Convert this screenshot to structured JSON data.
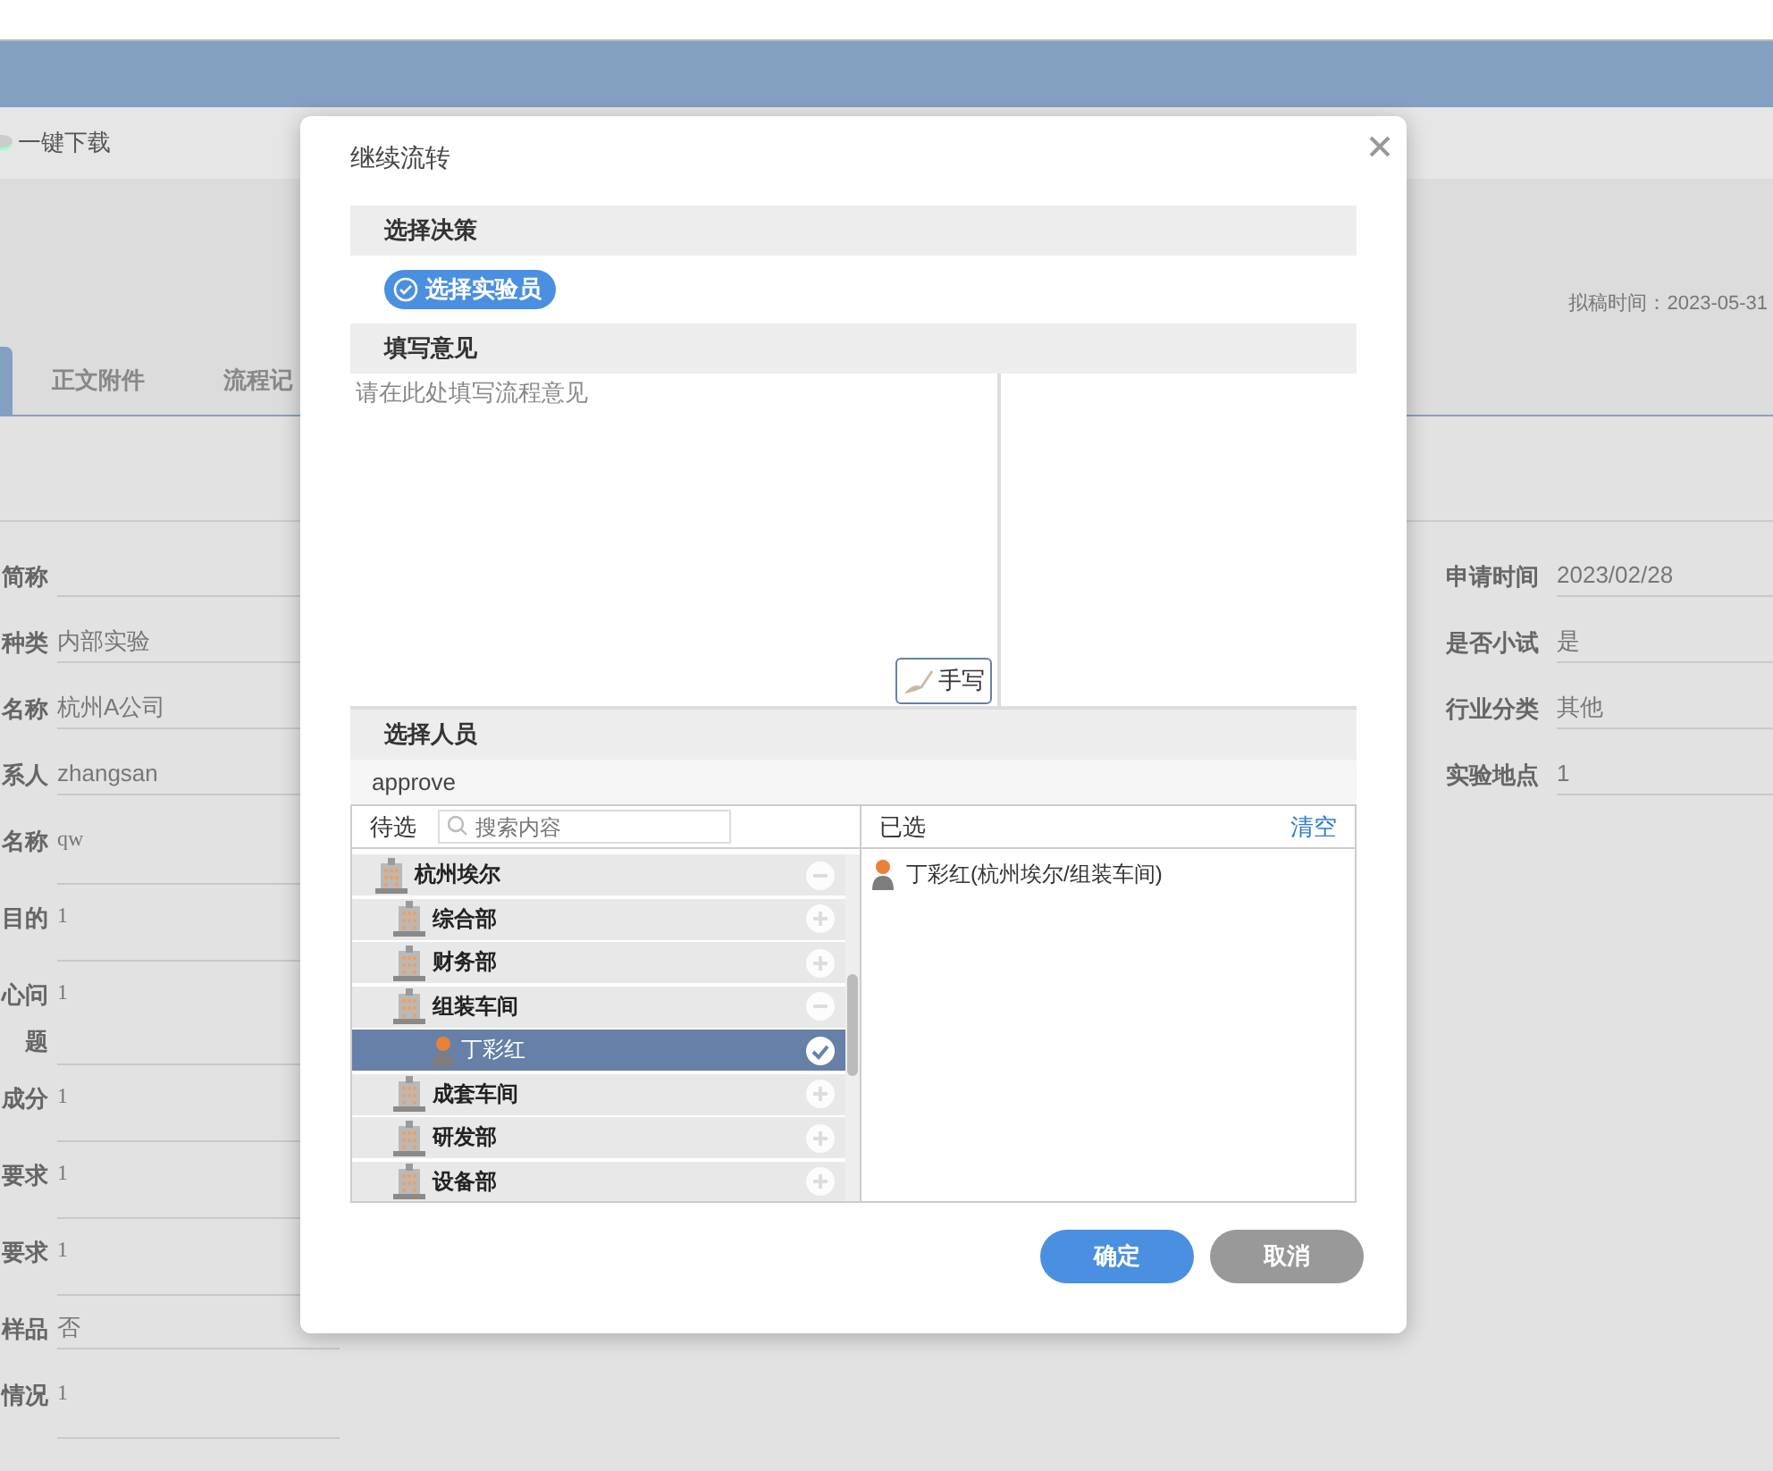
{
  "toolbar": {
    "download": "一键下载"
  },
  "header": {
    "draft_time": "拟稿时间：2023-05-31"
  },
  "tabs": [
    {
      "selected": true
    },
    {
      "label": "正文附件",
      "selected": false
    },
    {
      "label": "流程记",
      "selected": false
    }
  ],
  "form": {
    "left": [
      {
        "label": "简称",
        "kind": "text"
      },
      {
        "label": "种类",
        "value": "内部实验",
        "kind": "text"
      },
      {
        "label": "名称",
        "value": "杭州A公司",
        "kind": "text"
      },
      {
        "label": "系人",
        "value": "zhangsan",
        "kind": "text"
      },
      {
        "label": "名称",
        "value": "qw",
        "kind": "area"
      },
      {
        "label": "目的",
        "value": "1",
        "kind": "area"
      },
      {
        "label": "心问题",
        "value": "1",
        "kind": "area"
      },
      {
        "label": "成分",
        "value": "1",
        "kind": "area"
      },
      {
        "label": "要求",
        "value": "1",
        "kind": "area"
      },
      {
        "label": "要求",
        "value": "1",
        "kind": "area"
      },
      {
        "label": "样品",
        "value": "否",
        "kind": "text"
      },
      {
        "label": "情况",
        "value": "1",
        "kind": "area"
      }
    ],
    "right": [
      {
        "label": "申请时间",
        "value": "2023/02/28"
      },
      {
        "label": "是否小试",
        "value": "是"
      },
      {
        "label": "行业分类",
        "value": "其他"
      },
      {
        "label": "实验地点",
        "value": "1"
      }
    ]
  },
  "dialog": {
    "title": "继续流转",
    "decision_header": "选择决策",
    "decisions": [
      {
        "label": "选择实验员",
        "selected": true
      }
    ],
    "opinion_header": "填写意见",
    "opinion": {
      "placeholder": "请在此处填写流程意见"
    },
    "handwrite_button": "手写",
    "people_header": "选择人员",
    "step": "approve",
    "candidates_label": "待选",
    "search": {
      "placeholder": "搜索内容"
    },
    "selected_label": "已选",
    "clear_link": "清空",
    "tree": [
      {
        "label": "杭州埃尔",
        "kind": "org",
        "expanded": true,
        "selected": false,
        "children": [
          {
            "label": "综合部",
            "kind": "org",
            "expanded": false,
            "selected": false
          },
          {
            "label": "财务部",
            "kind": "org",
            "expanded": false,
            "selected": false
          },
          {
            "label": "组装车间",
            "kind": "org",
            "expanded": true,
            "selected": false,
            "children": [
              {
                "label": "丁彩红",
                "kind": "person",
                "selected": true
              }
            ]
          },
          {
            "label": "成套车间",
            "kind": "org",
            "expanded": false,
            "selected": false
          },
          {
            "label": "研发部",
            "kind": "org",
            "expanded": false,
            "selected": false
          },
          {
            "label": "设备部",
            "kind": "org",
            "expanded": false,
            "selected": false
          }
        ]
      }
    ],
    "chosen": [
      "丁彩红(杭州埃尔/组装车间)"
    ],
    "buttons": [
      {
        "label": "确定",
        "kind": "primary"
      },
      {
        "label": "取消",
        "kind": "secondary"
      }
    ]
  }
}
